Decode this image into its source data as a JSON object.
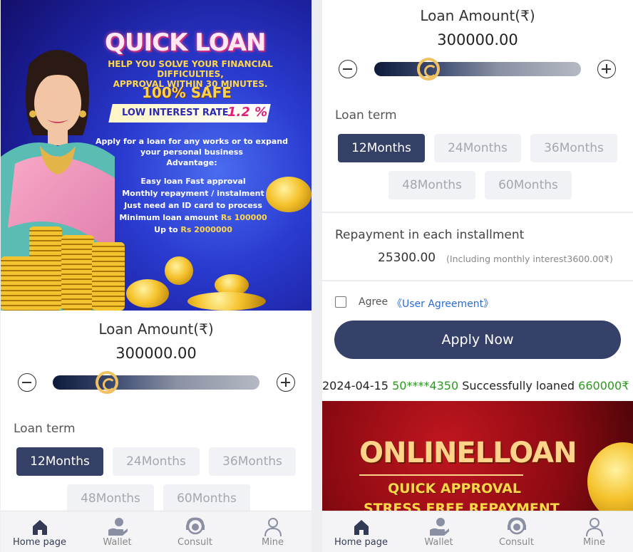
{
  "banner": {
    "title": "QUICK LOAN",
    "subtitle_1": "HELP YOU SOLVE YOUR FINANCIAL DIFFICULTIES,",
    "subtitle_2": "APPROVAL WITHIN 30 MINUTES.",
    "safe": "100% SAFE",
    "rate_label": "LOW INTEREST RATE",
    "rate_value": "1.2 %",
    "apply_1": "Apply for a loan for any works or to expand",
    "apply_2": "your personal business",
    "apply_3": "Advantage:",
    "adv_1": "Easy loan Fast approval",
    "adv_2": "Monthly repayment / instalment",
    "adv_3": "Just need an ID card to process",
    "adv_4_text": "Minimum loan amount ",
    "adv_4_value": "Rs 100000",
    "adv_5_text": "Up to ",
    "adv_5_value": "Rs 2000000"
  },
  "loan": {
    "amount_label": "Loan Amount(₹)",
    "amount_value": "300000.00",
    "slider_fraction": 0.22,
    "term_label": "Loan term",
    "terms": [
      "12Months",
      "24Months",
      "36Months",
      "48Months",
      "60Months"
    ],
    "selected_term": "12Months"
  },
  "repayment": {
    "label": "Repayment in each installment",
    "value": "25300.00",
    "note": "(Including monthly interest3600.00₹)"
  },
  "agreement": {
    "agree": "Agree",
    "link": "《User Agreement》"
  },
  "apply_button": "Apply Now",
  "ticker": {
    "date": "2024-04-15",
    "phone": "50****4350",
    "text": "Successfully loaned",
    "amount": "660000₹ ."
  },
  "banner2": {
    "title": "ONLINELLOAN",
    "line_1": "QUICK APPROVAL",
    "line_2": "STRESS FREE REPAYMENT"
  },
  "nav": [
    {
      "label": "Home page",
      "icon": "home-icon",
      "active": true
    },
    {
      "label": "Wallet",
      "icon": "wallet-icon",
      "active": false
    },
    {
      "label": "Consult",
      "icon": "consult-icon",
      "active": false
    },
    {
      "label": "Mine",
      "icon": "person-icon",
      "active": false
    }
  ],
  "colors": {
    "primary": "#354066",
    "accent_gold": "#f0c264",
    "link": "#2c6bd6",
    "success_green": "#2a9b1e"
  }
}
